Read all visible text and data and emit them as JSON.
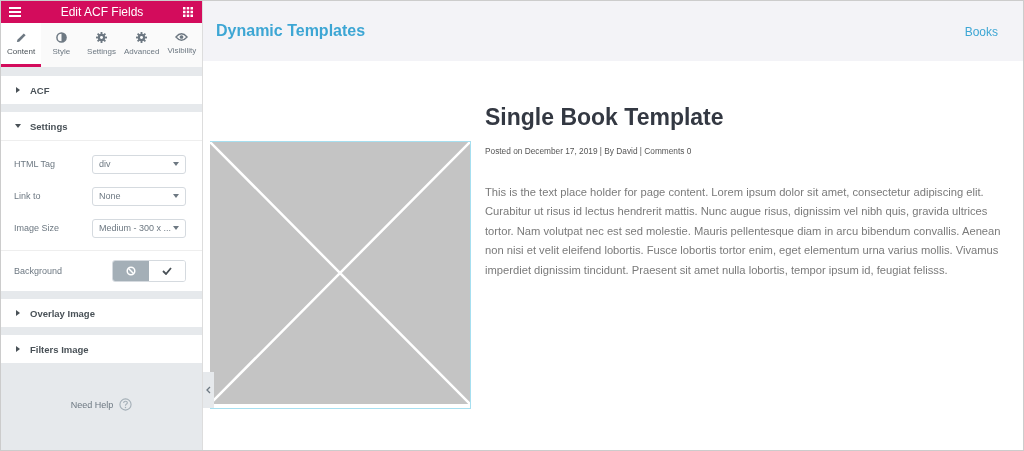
{
  "panel": {
    "title": "Edit ACF Fields",
    "tabs": [
      {
        "label": "Content",
        "selected": true
      },
      {
        "label": "Style",
        "selected": false
      },
      {
        "label": "Settings",
        "selected": false
      },
      {
        "label": "Advanced",
        "selected": false
      },
      {
        "label": "Visibility",
        "selected": false
      }
    ],
    "sections": [
      {
        "title": "ACF",
        "expanded": false
      },
      {
        "title": "Settings",
        "expanded": true,
        "controls": [
          {
            "kind": "select",
            "label": "HTML Tag",
            "value": "div"
          },
          {
            "kind": "select",
            "label": "Link to",
            "value": "None"
          },
          {
            "kind": "select",
            "label": "Image Size",
            "value": "Medium - 300 x ..."
          },
          {
            "kind": "toggle",
            "label": "Background",
            "options": [
              {
                "selected": true
              },
              {
                "selected": false
              }
            ]
          }
        ]
      },
      {
        "title": "Overlay Image",
        "expanded": false
      },
      {
        "title": "Filters Image",
        "expanded": false
      }
    ],
    "help": "Need Help"
  },
  "preview": {
    "site_title": "Dynamic Templates",
    "nav": [
      "Books"
    ],
    "post_title": "Single Book Template",
    "meta": "Posted on December 17, 2019 | By David | Comments 0",
    "body": "This is the text place holder for page content. Lorem ipsum dolor sit amet, consectetur adipiscing elit. Curabitur ut risus id lectus hendrerit mattis. Nunc augue risus, dignissim vel nibh quis, gravida ultrices tortor. Nam volutpat nec est sed molestie. Mauris pellentesque diam in arcu bibendum convallis. Aenean non nisi et velit eleifend lobortis. Fusce lobortis tortor enim, eget elementum urna varius mollis. Vivamus imperdiet dignissim tincidunt. Praesent sit amet nulla lobortis, tempor ipsum id, feugiat felisss."
  }
}
